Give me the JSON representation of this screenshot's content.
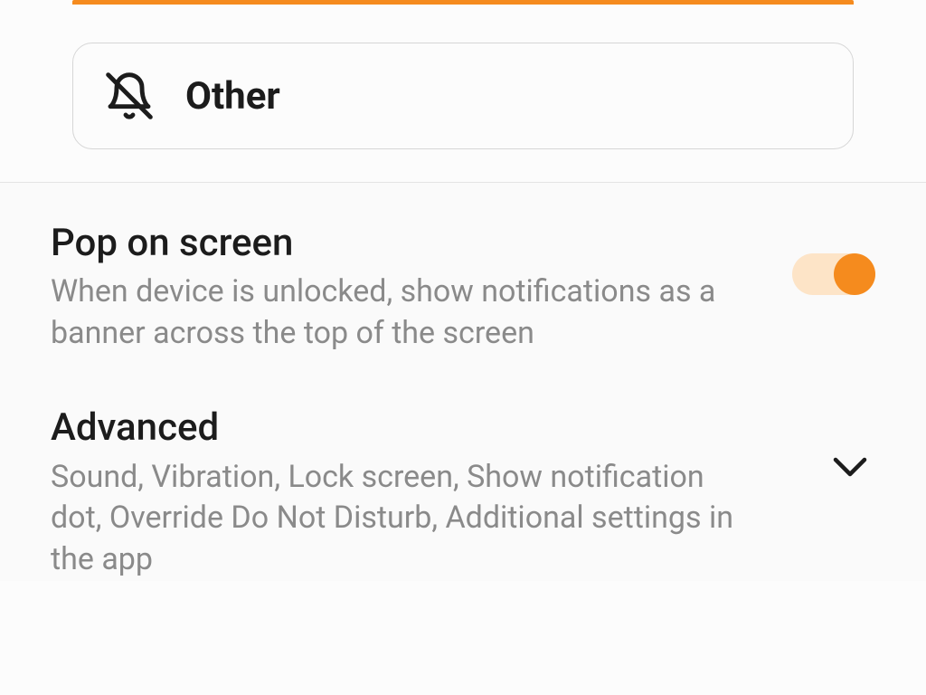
{
  "other_card": {
    "label": "Other"
  },
  "pop_on_screen": {
    "title": "Pop on screen",
    "description": "When device is unlocked, show notifications as a banner across the top of the screen",
    "enabled": true
  },
  "advanced": {
    "title": "Advanced",
    "description": "Sound, Vibration, Lock screen, Show notification dot, Override Do Not Disturb, Additional settings in the app"
  }
}
